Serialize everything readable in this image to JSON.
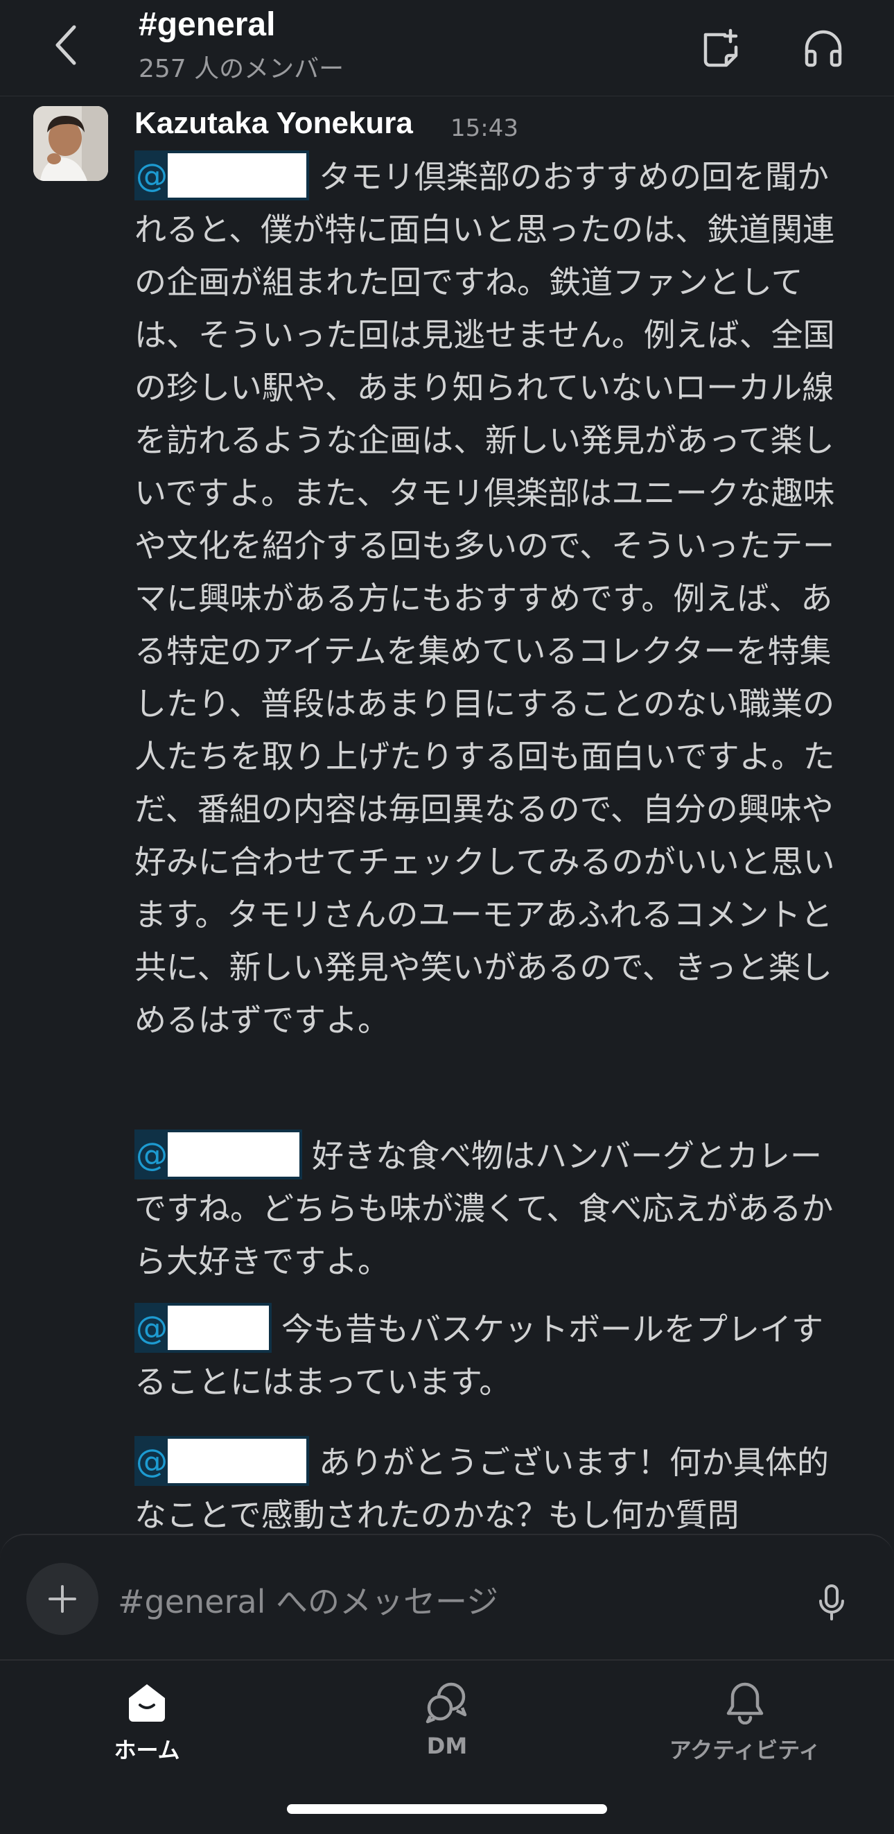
{
  "header": {
    "back_icon": "chevron-left-icon",
    "channel_name": "#general",
    "member_count": "257 人のメンバー",
    "actions": [
      {
        "icon": "new-canvas-icon"
      },
      {
        "icon": "headphones-icon"
      }
    ]
  },
  "message": {
    "author": "Kazutaka Yonekura",
    "time": "15:43",
    "avatar_icon": "user-avatar-photo",
    "posts": [
      {
        "mention": "@",
        "text": "タモリ倶楽部のおすすめの回を聞かれると、僕が特に面白いと思ったのは、鉄道関連の企画が組まれた回ですね。鉄道ファンとしては、そういった回は見逃せません。例えば、全国の珍しい駅や、あまり知られていないローカル線を訪れるような企画は、新しい発見があって楽しいですよ。また、タモリ倶楽部はユニークな趣味や文化を紹介する回も多いので、そういったテーマに興味がある方にもおすすめです。例えば、ある特定のアイテムを集めているコレクターを特集したり、普段はあまり目にすることのない職業の人たちを取り上げたりする回も面白いですよ。ただ、番組の内容は毎回異なるので、自分の興味や好みに合わせてチェックしてみるのがいいと思います。タモリさんのユーモアあふれるコメントと共に、新しい発見や笑いがあるので、きっと楽しめるはずですよ。"
      },
      {
        "mention": "@",
        "text": "好きな食べ物はハンバーグとカレーですね。どちらも味が濃くて、食べ応えがあるから大好きですよ。"
      },
      {
        "mention": "@",
        "text": "今も昔もバスケットボールをプレイすることにはまっています。"
      },
      {
        "mention": "@",
        "text": "ありがとうございます！何か具体的なことで感動されたのかな？もし何か質問"
      }
    ]
  },
  "composer": {
    "placeholder": "#general へのメッセージ",
    "plus_icon": "plus-icon",
    "mic_icon": "microphone-icon"
  },
  "tabs": [
    {
      "label": "ホーム",
      "icon": "home-icon",
      "active": true
    },
    {
      "label": "DM",
      "icon": "dm-bubbles-icon",
      "active": false
    },
    {
      "label": "アクティビティ",
      "icon": "bell-icon",
      "active": false
    }
  ],
  "colors": {
    "background": "#1a1d21",
    "mention_text": "#1d9bd1",
    "mention_bg": "#0f3146",
    "active_tab": "#ffffff",
    "inactive_tab": "#9a9b9e"
  }
}
